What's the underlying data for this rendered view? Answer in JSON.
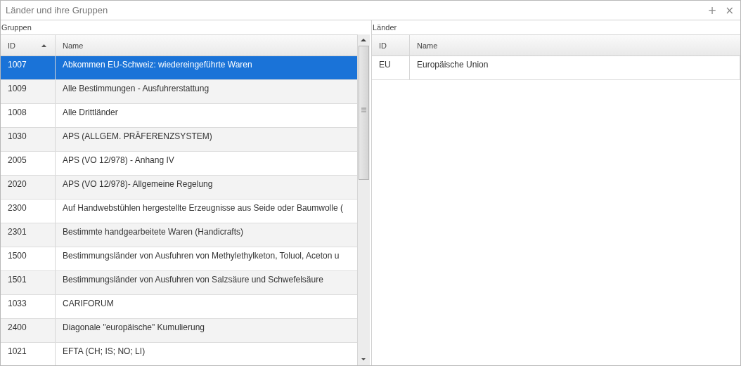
{
  "window": {
    "title": "Länder und ihre Gruppen",
    "buttons": [
      "+",
      "×"
    ]
  },
  "groups_panel": {
    "title": "Gruppen",
    "columns": [
      {
        "label": "ID",
        "sorted": true
      },
      {
        "label": "Name",
        "sorted": false
      }
    ],
    "rows": [
      {
        "id": "1007",
        "name": "Abkommen EU-Schweiz: wiedereingeführte Waren",
        "selected": true
      },
      {
        "id": "1009",
        "name": "Alle Bestimmungen - Ausfuhrerstattung",
        "selected": false
      },
      {
        "id": "1008",
        "name": "Alle Drittländer",
        "selected": false
      },
      {
        "id": "1030",
        "name": "APS (ALLGEM. PRÄFERENZSYSTEM)",
        "selected": false
      },
      {
        "id": "2005",
        "name": "APS (VO 12/978) - Anhang IV",
        "selected": false
      },
      {
        "id": "2020",
        "name": "APS (VO 12/978)- Allgemeine Regelung",
        "selected": false
      },
      {
        "id": "2300",
        "name": "Auf Handwebstühlen hergestellte Erzeugnisse aus Seide oder Baumwolle (",
        "selected": false
      },
      {
        "id": "2301",
        "name": "Bestimmte handgearbeitete Waren (Handicrafts)",
        "selected": false
      },
      {
        "id": "1500",
        "name": "Bestimmungsländer von Ausfuhren von Methylethylketon, Toluol, Aceton u",
        "selected": false
      },
      {
        "id": "1501",
        "name": "Bestimmungsländer von Ausfuhren von Salzsäure und Schwefelsäure",
        "selected": false
      },
      {
        "id": "1033",
        "name": "CARIFORUM",
        "selected": false
      },
      {
        "id": "2400",
        "name": "Diagonale \"europäische\" Kumulierung",
        "selected": false
      },
      {
        "id": "1021",
        "name": "EFTA (CH; IS; NO; LI)",
        "selected": false
      }
    ]
  },
  "countries_panel": {
    "title": "Länder",
    "columns": [
      {
        "label": "ID",
        "sorted": false
      },
      {
        "label": "Name",
        "sorted": false
      }
    ],
    "rows": [
      {
        "id": "EU",
        "name": "Europäische Union",
        "selected": false
      }
    ]
  }
}
